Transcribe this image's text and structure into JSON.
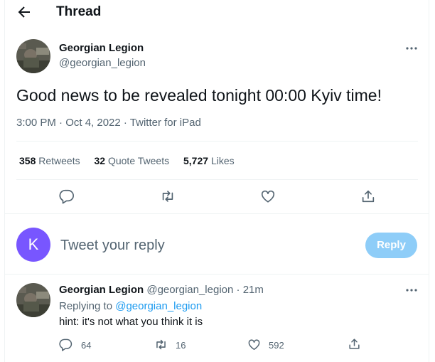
{
  "header": {
    "title": "Thread"
  },
  "main_tweet": {
    "author_name": "Georgian Legion",
    "author_handle": "@georgian_legion",
    "text": "Good news to be revealed tonight 00:00 Kyiv time!",
    "meta": "3:00 PM · Oct 4, 2022 · Twitter for iPad",
    "stats": {
      "retweets_count": "358",
      "retweets_label": "Retweets",
      "quotes_count": "32",
      "quotes_label": "Quote Tweets",
      "likes_count": "5,727",
      "likes_label": "Likes"
    },
    "actions": [
      "reply-icon",
      "retweet-icon",
      "like-icon",
      "share-icon"
    ]
  },
  "composer": {
    "avatar_letter": "K",
    "avatar_color": "#7856ff",
    "placeholder": "Tweet your reply",
    "reply_button": "Reply"
  },
  "reply_tweet": {
    "author_name": "Georgian Legion",
    "author_handle": "@georgian_legion",
    "time": "· 21m",
    "replying_prefix": "Replying to",
    "replying_to": "@georgian_legion",
    "text": "hint: it's not what you think it is",
    "counts": {
      "replies": "64",
      "retweets": "16",
      "likes": "592"
    }
  },
  "colors": {
    "accent": "#1d9bf0",
    "reply_button_disabled": "#8ecdf8",
    "secondary_text": "#536471"
  }
}
